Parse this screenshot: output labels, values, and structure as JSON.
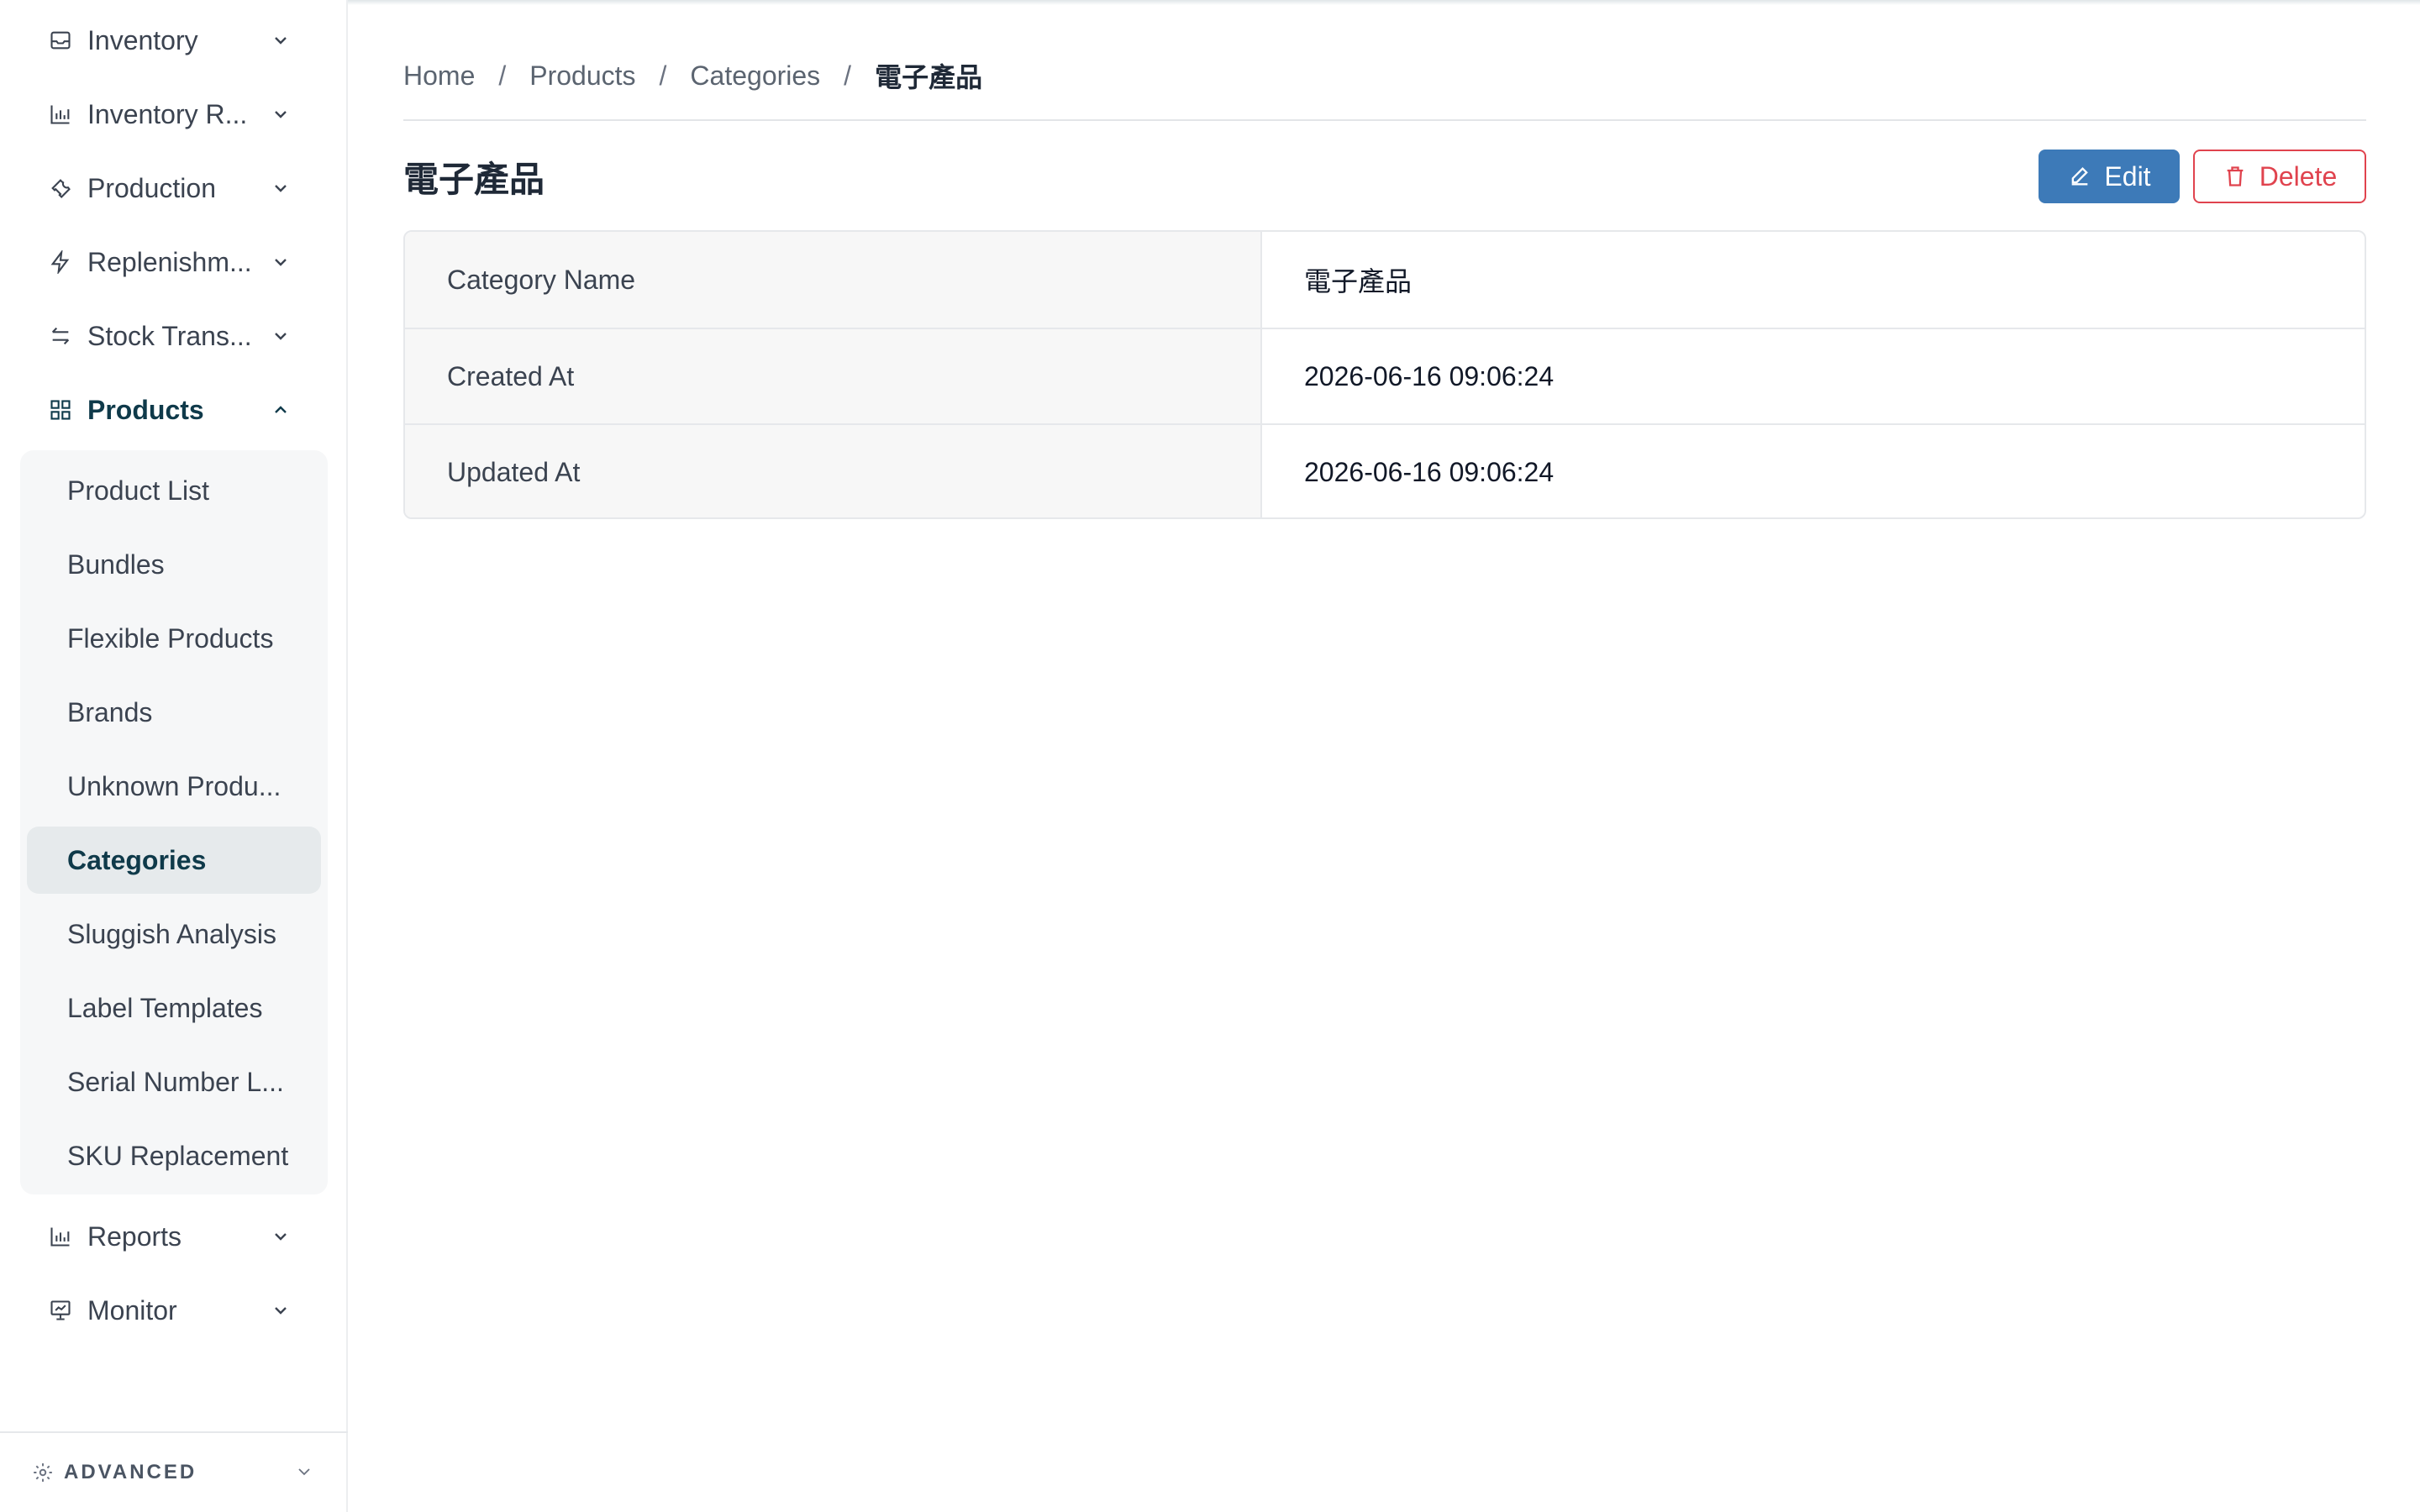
{
  "sidebar": {
    "items": [
      {
        "label": "Inventory",
        "icon": "inbox-icon"
      },
      {
        "label": "Inventory R...",
        "icon": "bar-chart-icon"
      },
      {
        "label": "Production",
        "icon": "wrench-icon"
      },
      {
        "label": "Replenishm...",
        "icon": "lightning-icon"
      },
      {
        "label": "Stock Trans...",
        "icon": "transfer-arrows-icon"
      },
      {
        "label": "Products",
        "icon": "grid-icon"
      },
      {
        "label": "Reports",
        "icon": "bar-chart-icon"
      },
      {
        "label": "Monitor",
        "icon": "presentation-chart-icon"
      }
    ],
    "products_submenu": [
      {
        "label": "Product List"
      },
      {
        "label": "Bundles"
      },
      {
        "label": "Flexible Products"
      },
      {
        "label": "Brands"
      },
      {
        "label": "Unknown Produ..."
      },
      {
        "label": "Categories"
      },
      {
        "label": "Sluggish Analysis"
      },
      {
        "label": "Label Templates"
      },
      {
        "label": "Serial Number L..."
      },
      {
        "label": "SKU Replacement"
      }
    ],
    "advanced_label": "ADVANCED"
  },
  "breadcrumb": {
    "items": [
      "Home",
      "Products",
      "Categories"
    ],
    "current": "電子產品",
    "separator": "/"
  },
  "page": {
    "title": "電子產品",
    "edit_label": "Edit",
    "delete_label": "Delete"
  },
  "details": {
    "rows": [
      {
        "key": "Category Name",
        "value": "電子產品"
      },
      {
        "key": "Created At",
        "value": "2026-06-16 09:06:24"
      },
      {
        "key": "Updated At",
        "value": "2026-06-16 09:06:24"
      }
    ]
  },
  "colors": {
    "accent": "#3d7ab8",
    "danger": "#e0434e",
    "active_text": "#0f3a4a"
  }
}
